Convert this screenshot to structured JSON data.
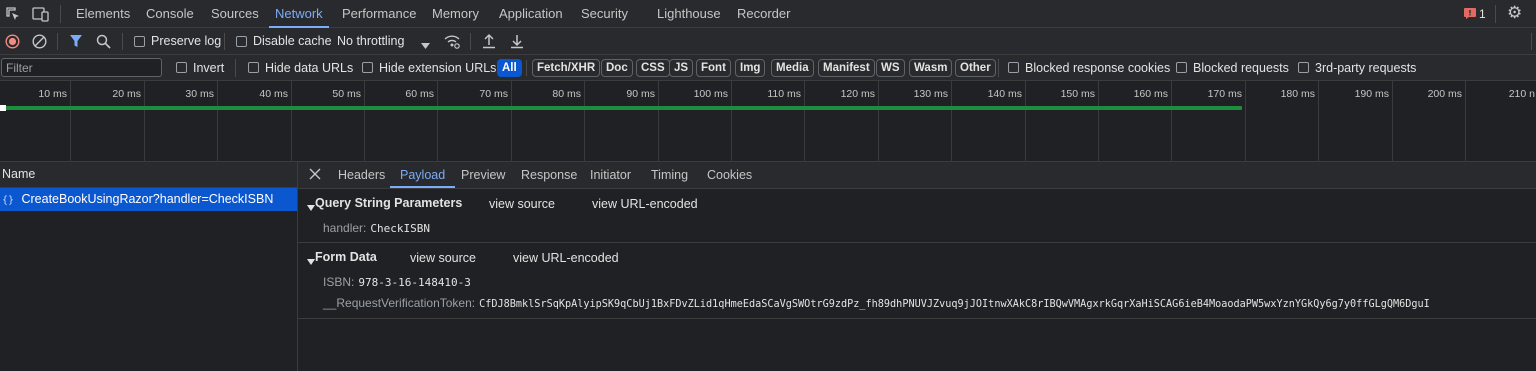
{
  "topbar": {
    "tabs": [
      "Elements",
      "Console",
      "Sources",
      "Network",
      "Performance",
      "Memory",
      "Application",
      "Security",
      "Lighthouse",
      "Recorder"
    ],
    "active_tab": "Network",
    "issues_count": "1",
    "icons": [
      "inspect-element-icon",
      "device-toolbar-icon",
      "issues-flag-icon",
      "settings-gear-icon"
    ]
  },
  "toolbar": {
    "preserve_log": "Preserve log",
    "disable_cache": "Disable cache",
    "throttling": "No throttling",
    "icons": [
      "record-icon",
      "clear-icon",
      "filter-icon",
      "search-icon",
      "network-conditions-icon",
      "import-har-icon",
      "export-har-icon"
    ]
  },
  "filterbar": {
    "placeholder": "Filter",
    "invert": "Invert",
    "hide_data_urls": "Hide data URLs",
    "hide_extension_urls": "Hide extension URLs",
    "types": [
      "All",
      "Fetch/XHR",
      "Doc",
      "CSS",
      "JS",
      "Font",
      "Img",
      "Media",
      "Manifest",
      "WS",
      "Wasm",
      "Other"
    ],
    "active_type": "All",
    "blocked_response_cookies": "Blocked response cookies",
    "blocked_requests": "Blocked requests",
    "third_party": "3rd-party requests"
  },
  "overview": {
    "ticks": [
      "10 ms",
      "20 ms",
      "30 ms",
      "40 ms",
      "50 ms",
      "60 ms",
      "70 ms",
      "80 ms",
      "90 ms",
      "100 ms",
      "110 ms",
      "120 ms",
      "130 ms",
      "140 ms",
      "150 ms",
      "160 ms",
      "170 ms",
      "180 ms",
      "190 ms",
      "200 ms",
      "210 n"
    ],
    "request_end_ms": 172
  },
  "requests": {
    "column_name": "Name",
    "items": [
      {
        "name": "CreateBookUsingRazor?handler=CheckISBN",
        "icon": "fetch-icon"
      }
    ]
  },
  "detail": {
    "tabs": [
      "Headers",
      "Payload",
      "Preview",
      "Response",
      "Initiator",
      "Timing",
      "Cookies"
    ],
    "active_tab": "Payload",
    "query_section": {
      "title": "Query String Parameters",
      "view_source": "view source",
      "view_url_encoded": "view URL-encoded",
      "params": [
        {
          "key": "handler:",
          "value": "CheckISBN"
        }
      ]
    },
    "form_section": {
      "title": "Form Data",
      "view_source": "view source",
      "view_url_encoded": "view URL-encoded",
      "params": [
        {
          "key": "ISBN:",
          "value": "978-3-16-148410-3"
        },
        {
          "key": "__RequestVerificationToken:",
          "value": "CfDJ8BmklSrSqKpAlyipSK9qCbUj1BxFDvZLid1qHmeEdaSCaVgSWOtrG9zdPz_fh89dhPNUVJZvuq9jJOItnwXAkC8rIBQwVMAgxrkGqrXaHiSCAG6ieB4MoaodaPW5wxYznYGkQy6g7y0ffGLgQM6DguI"
        }
      ]
    }
  },
  "colors": {
    "accent": "#7cacf8",
    "selected_row": "#0b57d0",
    "record_red": "#f28b82",
    "waterfall_bar": "#1e8e3e"
  }
}
